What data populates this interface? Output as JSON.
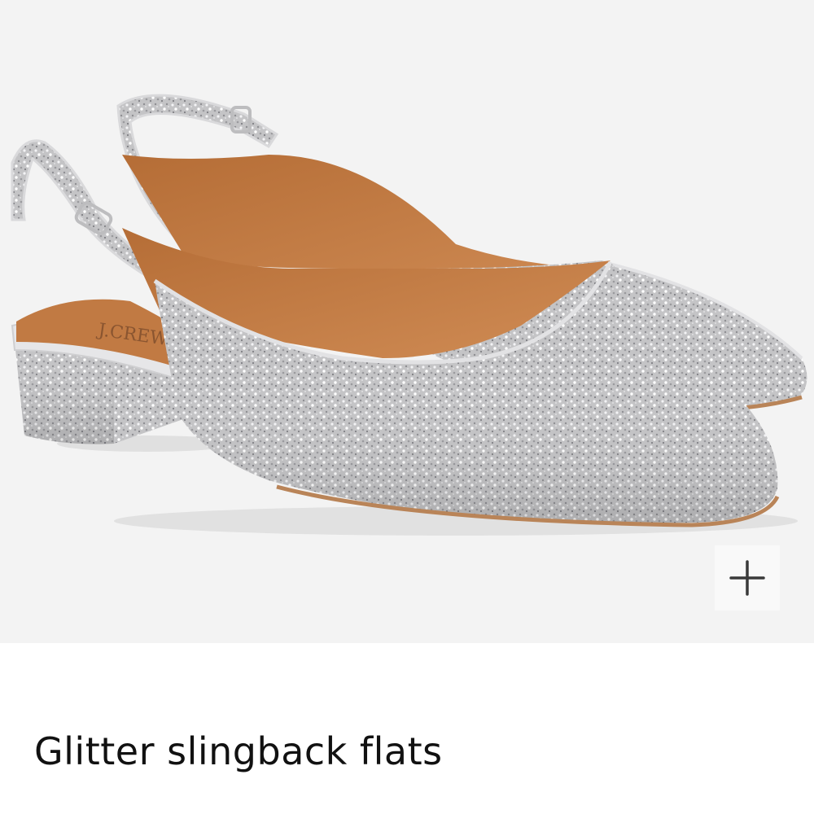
{
  "product": {
    "title": "Glitter slingback flats",
    "image_alt": "Silver glitter pointed-toe slingback flats with block heels",
    "insole_brand_mark": "J.CREW",
    "zoom_button_label": "+",
    "zoom_icon": "plus-icon"
  },
  "colors": {
    "image_background": "#f3f3f3",
    "glitter_silver": "#c4c4c6",
    "lining_tan": "#c27a42",
    "heel_lining": "#b5743f",
    "title_text": "#111111",
    "zoom_icon": "#3a3a3a"
  }
}
